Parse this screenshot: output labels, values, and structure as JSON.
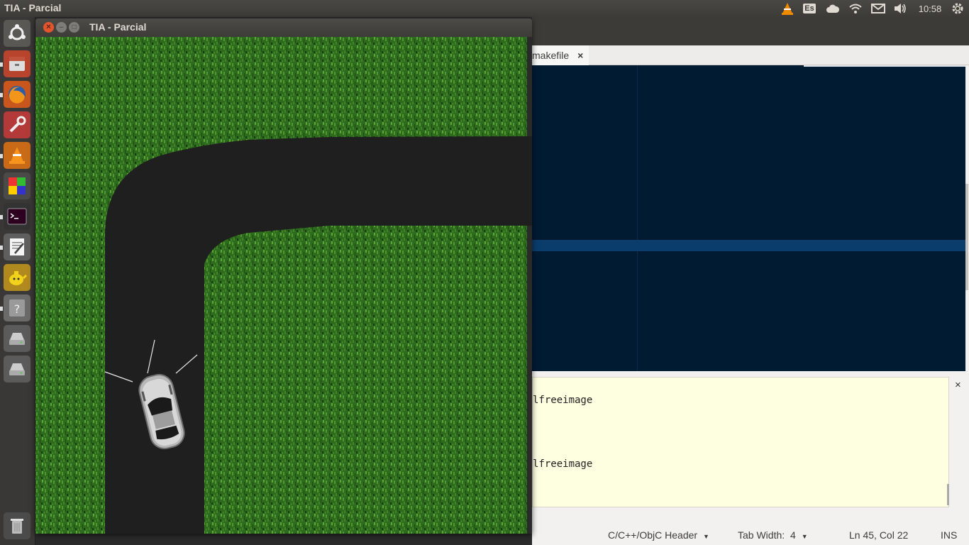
{
  "top_panel": {
    "title": "TIA - Parcial",
    "keyboard_layout": "Es",
    "clock": "10:58"
  },
  "launcher": {
    "items": [
      {
        "name": "dash-icon"
      },
      {
        "name": "files-icon"
      },
      {
        "name": "firefox-icon"
      },
      {
        "name": "system-settings-icon"
      },
      {
        "name": "vlc-icon"
      },
      {
        "name": "software-center-icon"
      },
      {
        "name": "terminal-icon"
      },
      {
        "name": "text-editor-icon"
      },
      {
        "name": "teapot-icon"
      },
      {
        "name": "unknown-app-icon"
      },
      {
        "name": "drive-icon"
      },
      {
        "name": "drive-icon"
      },
      {
        "name": "trash-icon"
      }
    ]
  },
  "game_window": {
    "title": "TIA - Parcial"
  },
  "editor": {
    "tab_label": "makefile",
    "tab_close": "×",
    "output_lines": [
      "lfreeimage",
      "lfreeimage"
    ],
    "pane_close": "×",
    "status": {
      "language": "C/C++/ObjC Header",
      "tab_width_label": "Tab Width:",
      "tab_width_value": "4",
      "position": "Ln 45, Col 22",
      "mode": "INS"
    }
  },
  "colors": {
    "grass": "#2f6b1f",
    "road": "#1f1f1f",
    "code_bg": "#011b33",
    "output_bg": "#fefee0",
    "close_button": "#e3552d"
  }
}
